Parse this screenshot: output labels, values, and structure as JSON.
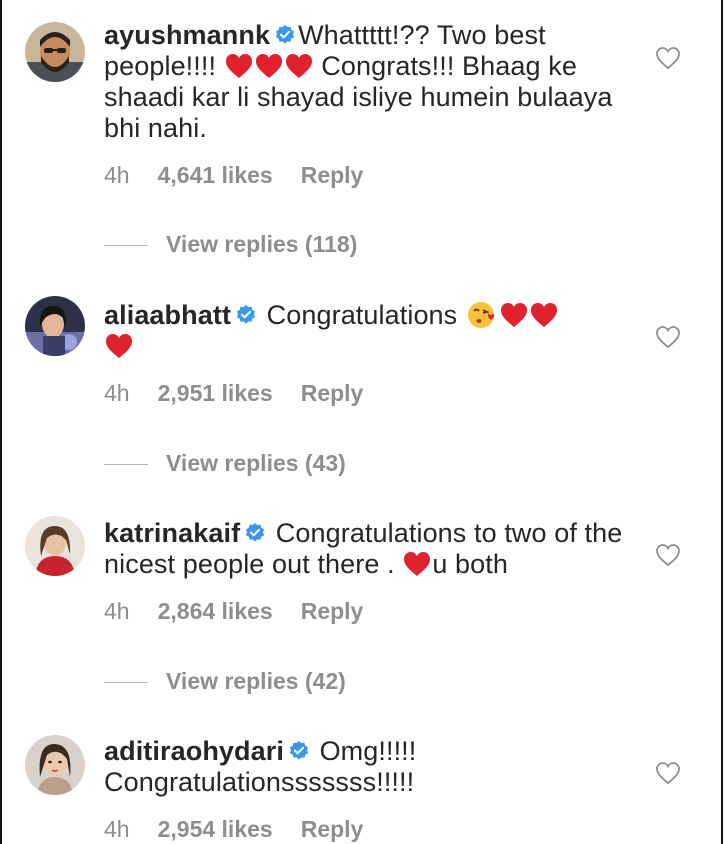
{
  "comments": [
    {
      "username": "ayushmannk",
      "avatar": "avatar-bearded-man",
      "text_parts": [
        "Whattttt!?? Two best people!!!! ",
        " Congrats!!! Bhaag ke shaadi kar li shayad isliye humein bulaaya bhi nahi."
      ],
      "time": "4h",
      "likes": "4,641 likes",
      "reply": "Reply",
      "view_replies": "View replies (118)"
    },
    {
      "username": "aliaabhatt",
      "avatar": "avatar-woman-dark",
      "text": "Congratulations",
      "time": "4h",
      "likes": "2,951 likes",
      "reply": "Reply",
      "view_replies": "View replies (43)"
    },
    {
      "username": "katrinakaif",
      "avatar": "avatar-woman-red",
      "text": "Congratulations to two of the nicest people out there .",
      "text_after": "u both",
      "time": "4h",
      "likes": "2,864 likes",
      "reply": "Reply",
      "view_replies": "View replies (42)"
    },
    {
      "username": "aditiraohydari",
      "avatar": "avatar-woman-portrait",
      "text_line1": "Omg!!!!!",
      "text_line2": "Congratulationsssssss!!!!!",
      "time": "4h",
      "likes": "2,954 likes",
      "reply": "Reply"
    }
  ],
  "colors": {
    "text": "#262626",
    "muted": "#8e8e8e",
    "verified": "#3897f0",
    "heart": "#e0212e"
  },
  "icons": [
    "verified-badge-icon",
    "heart-emoji-icon",
    "kiss-emoji-icon",
    "like-heart-outline-icon"
  ]
}
